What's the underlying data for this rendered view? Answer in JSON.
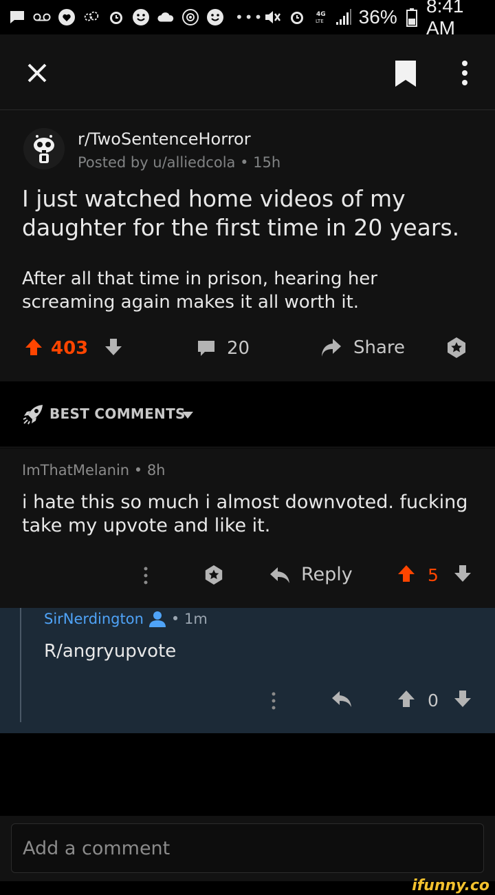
{
  "status_bar": {
    "battery": "36%",
    "time": "8:41 AM",
    "network": "4G LTE",
    "icons": [
      "message-icon",
      "voicemail-icon",
      "heart-icon",
      "cloud-sync-icon",
      "alarm-icon",
      "emoji-icon",
      "cloud-icon",
      "accessibility-icon",
      "emoji-icon",
      "mute-icon",
      "alarm-icon",
      "signal-icon",
      "battery-icon"
    ]
  },
  "app_bar": {
    "icons": [
      "close-icon",
      "bookmark-icon",
      "more-vertical-icon"
    ]
  },
  "post": {
    "subreddit": "r/TwoSentenceHorror",
    "meta": "Posted by u/alliedcola • 15h",
    "title": "I just watched home videos of my daughter for the first time in 20 years.",
    "body": "After all that time in prison, hearing her screaming again makes it all worth it.",
    "upvotes": "403",
    "comments": "20",
    "share_label": "Share"
  },
  "sort": {
    "label": "BEST COMMENTS"
  },
  "comments": [
    {
      "author_meta": "ImThatMelanin • 8h",
      "body": "i hate this so much i almost downvoted. fucking take my upvote and like it.",
      "reply_label": "Reply",
      "score": "5"
    },
    {
      "author": "SirNerdington",
      "time": "• 1m",
      "body": "R/angryupvote",
      "score": "0"
    }
  ],
  "composer": {
    "placeholder": "Add a comment"
  },
  "watermark": "ifunny.co",
  "colors": {
    "upvote_orange": "#ff4500",
    "reply_background": "#1c2a37",
    "op_blue": "#4fa3f7",
    "watermark_yellow": "#f2c12e"
  }
}
